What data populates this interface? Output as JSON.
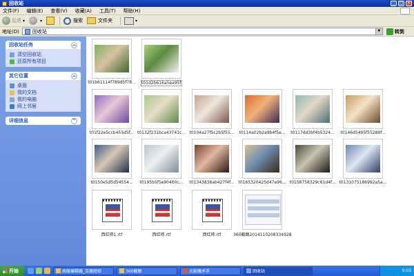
{
  "window": {
    "title": "回收站"
  },
  "menu": [
    "文件(F)",
    "编辑(E)",
    "查看(V)",
    "收藏(A)",
    "工具(T)",
    "帮助(H)"
  ],
  "toolbar": {
    "back": "后退",
    "search": "搜索",
    "folders": "文件夹"
  },
  "address": {
    "label": "地址(D)",
    "value": "回收站",
    "go": "转到"
  },
  "sidebar": {
    "tasks": {
      "title": "回收站任务",
      "items": [
        "清空回收站",
        "还原所有项目"
      ]
    },
    "places": {
      "title": "其它位置",
      "items": [
        "桌面",
        "我的文档",
        "我的电脑",
        "网上邻居"
      ]
    },
    "details": {
      "title": "详细信息"
    }
  },
  "files": [
    {
      "name": "t01b61114f789d5f78...",
      "kind": "photo",
      "colors": [
        "#7fb35a",
        "#d9c1a3",
        "#3e6b2a"
      ]
    },
    {
      "name": "t01d2b616a5ea95f2fc.jpg",
      "kind": "photo",
      "selected": true,
      "colors": [
        "#a9d37b",
        "#5c8a3d",
        "#f2f2f2"
      ]
    },
    {
      "name": "t01f22e5ccb455d5f...",
      "kind": "photo",
      "colors": [
        "#8a6cc0",
        "#e9c8d6",
        "#6b4aa0"
      ]
    },
    {
      "name": "t0132f231bca43741c...",
      "kind": "photo",
      "colors": [
        "#a7c98b",
        "#e8ddc9",
        "#5f8a4a"
      ]
    },
    {
      "name": "t0104a27f5c2b5f55...",
      "kind": "photo",
      "colors": [
        "#c4a58d",
        "#f1e6dc",
        "#7a5848"
      ]
    },
    {
      "name": "t0114a02b2a9b4f5e...",
      "kind": "photo",
      "colors": [
        "#e06a2f",
        "#f0b27a",
        "#3c2a50"
      ]
    },
    {
      "name": "t0117dd3bf4b5324...",
      "kind": "photo",
      "colors": [
        "#8fb7b3",
        "#e6d7c5",
        "#4a6f78"
      ]
    },
    {
      "name": "t0146d5495f55289f...",
      "kind": "photo",
      "colors": [
        "#c89a63",
        "#f5e3c5",
        "#6b4a2a"
      ]
    },
    {
      "name": "t0150e5d5d54554...",
      "kind": "photo",
      "colors": [
        "#3d5c8a",
        "#d9c8b5",
        "#1f2f4a"
      ]
    },
    {
      "name": "t0195b5f5e90460c...",
      "kind": "photo",
      "colors": [
        "#b9c7d2",
        "#eef0f1",
        "#7c8d99"
      ]
    },
    {
      "name": "t01343838ab427f4f...",
      "kind": "photo",
      "colors": [
        "#7a4030",
        "#e0b8a0",
        "#2d1810"
      ]
    },
    {
      "name": "t0165320425d47e96...",
      "kind": "photo",
      "colors": [
        "#d9c090",
        "#6f8fb0",
        "#3a2a1a"
      ]
    },
    {
      "name": "t0158758329c61d4f...",
      "kind": "photo",
      "colors": [
        "#4a4a3a",
        "#c9c3b0",
        "#1a1a14"
      ]
    },
    {
      "name": "t0131075186992a5a...",
      "kind": "photo",
      "colors": [
        "#6b86b8",
        "#dde6f2",
        "#2f3f66"
      ]
    },
    {
      "name": "西红柿1.rtf",
      "kind": "rtf"
    },
    {
      "name": "西红柿.rtf",
      "kind": "rtf"
    },
    {
      "name": "西红柿.rtf",
      "kind": "rtf"
    },
    {
      "name": "360截图20141102083349281...",
      "kind": "screenshot"
    }
  ],
  "taskbar": {
    "start": "开始",
    "tasks": [
      "高级编辑器_百度经验",
      "360截图",
      "光影魔术手",
      "回收站"
    ],
    "clock": "9:03"
  }
}
